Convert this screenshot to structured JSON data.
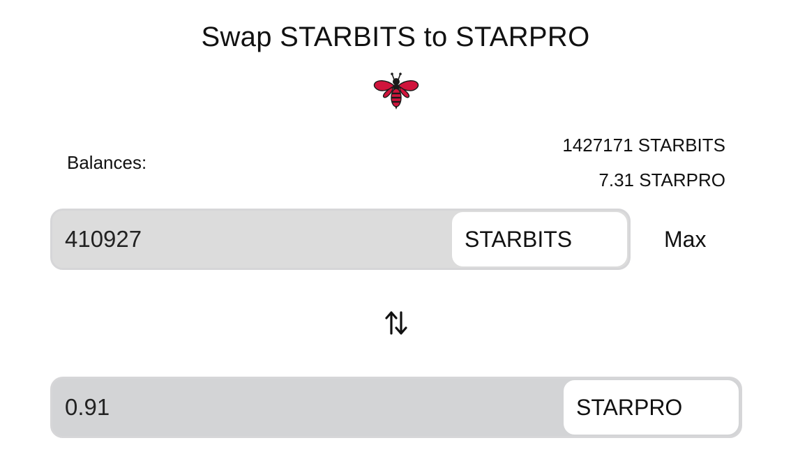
{
  "title": "Swap STARBITS to STARPRO",
  "logo_icon": "bee-icon",
  "balances": {
    "label": "Balances:",
    "from_balance": "1427171 STARBITS",
    "to_balance": "7.31 STARPRO"
  },
  "from_field": {
    "amount": "410927",
    "token": "STARBITS"
  },
  "max_label": "Max",
  "swap_direction_icon": "swap-vertical-arrows-icon",
  "to_field": {
    "amount": "0.91",
    "token": "STARPRO"
  },
  "colors": {
    "bee_red": "#d0143c",
    "bee_dark": "#1a1a1a",
    "field_from_bg": "#dcdcdc",
    "field_to_bg": "#d3d4d6"
  }
}
